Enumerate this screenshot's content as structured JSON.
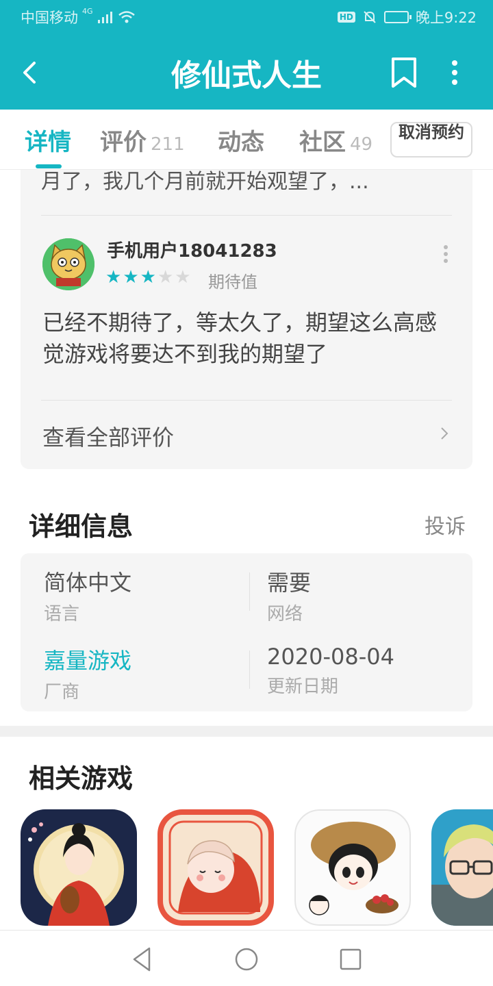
{
  "status_bar": {
    "carrier": "中国移动",
    "network": "4G",
    "hd": "HD",
    "time": "晚上9:22"
  },
  "header": {
    "title": "修仙式人生",
    "back_icon": "chevron-left-icon",
    "bookmark_icon": "bookmark-icon",
    "more_icon": "more-vertical-icon",
    "color": "#16b6c3"
  },
  "tabs": [
    {
      "label": "详情",
      "count": "",
      "active": true
    },
    {
      "label": "评价",
      "count": "211",
      "active": false
    },
    {
      "label": "动态",
      "count": "",
      "active": false
    },
    {
      "label": "社区",
      "count": "49",
      "active": false
    }
  ],
  "reserve_button": {
    "label": "取消预约"
  },
  "review": {
    "previous_text": "月了，我几个月前就开始观望了，...",
    "username": "手机用户18041283",
    "rating": 3,
    "rating_max": 5,
    "rating_label": "期待值",
    "text": "已经不期待了，等太久了，期望这么高感觉游戏将要达不到我的期望了",
    "see_all": "查看全部评价"
  },
  "details": {
    "title": "详细信息",
    "complain": "投诉",
    "items": [
      {
        "value": "简体中文",
        "label": "语言"
      },
      {
        "value": "需要",
        "label": "网络"
      },
      {
        "value": "嘉量游戏",
        "label": "厂商"
      },
      {
        "value": "2020-08-04",
        "label": "更新日期"
      }
    ]
  },
  "related": {
    "title": "相关游戏"
  }
}
